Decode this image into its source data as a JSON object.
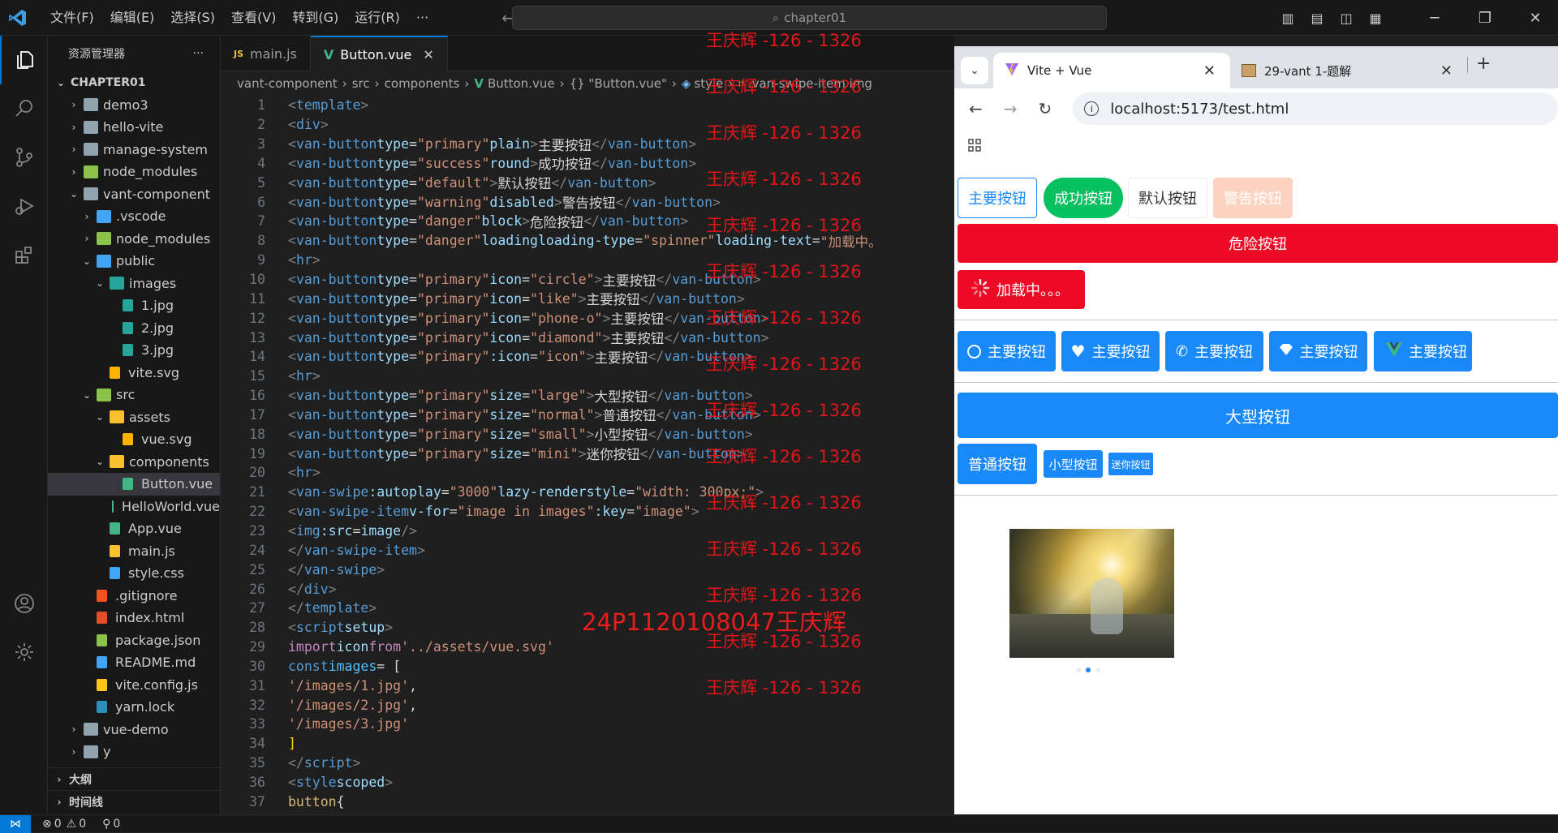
{
  "titlebar": {
    "menu": [
      "文件(F)",
      "编辑(E)",
      "选择(S)",
      "查看(V)",
      "转到(G)",
      "运行(R)",
      "···"
    ],
    "search_text": "chapter01"
  },
  "sidebar": {
    "title": "资源管理器",
    "more": "···",
    "root": "CHAPTER01",
    "items": [
      {
        "label": "demo3",
        "level": 1,
        "kind": "folder",
        "tw": "›"
      },
      {
        "label": "hello-vite",
        "level": 1,
        "kind": "folder",
        "tw": "›"
      },
      {
        "label": "manage-system",
        "level": 1,
        "kind": "folder",
        "tw": "›"
      },
      {
        "label": "node_modules",
        "level": 1,
        "kind": "folder-green",
        "tw": "›"
      },
      {
        "label": "vant-component",
        "level": 1,
        "kind": "folder",
        "tw": "⌄"
      },
      {
        "label": ".vscode",
        "level": 2,
        "kind": "folder-blue",
        "tw": "›"
      },
      {
        "label": "node_modules",
        "level": 2,
        "kind": "folder-green",
        "tw": "›"
      },
      {
        "label": "public",
        "level": 2,
        "kind": "folder-blue",
        "tw": "⌄"
      },
      {
        "label": "images",
        "level": 3,
        "kind": "folder-teal",
        "tw": "⌄"
      },
      {
        "label": "1.jpg",
        "level": 4,
        "kind": "image",
        "tw": ""
      },
      {
        "label": "2.jpg",
        "level": 4,
        "kind": "image",
        "tw": ""
      },
      {
        "label": "3.jpg",
        "level": 4,
        "kind": "image",
        "tw": ""
      },
      {
        "label": "vite.svg",
        "level": 3,
        "kind": "svg",
        "tw": ""
      },
      {
        "label": "src",
        "level": 2,
        "kind": "folder-green",
        "tw": "⌄"
      },
      {
        "label": "assets",
        "level": 3,
        "kind": "folder-yellow",
        "tw": "⌄"
      },
      {
        "label": "vue.svg",
        "level": 4,
        "kind": "svg",
        "tw": ""
      },
      {
        "label": "components",
        "level": 3,
        "kind": "folder-yellow",
        "tw": "⌄"
      },
      {
        "label": "Button.vue",
        "level": 4,
        "kind": "vue",
        "tw": "",
        "selected": true
      },
      {
        "label": "HelloWorld.vue",
        "level": 4,
        "kind": "vue",
        "tw": ""
      },
      {
        "label": "App.vue",
        "level": 3,
        "kind": "vue",
        "tw": ""
      },
      {
        "label": "main.js",
        "level": 3,
        "kind": "js",
        "tw": ""
      },
      {
        "label": "style.css",
        "level": 3,
        "kind": "css",
        "tw": ""
      },
      {
        "label": ".gitignore",
        "level": 2,
        "kind": "git",
        "tw": ""
      },
      {
        "label": "index.html",
        "level": 2,
        "kind": "html",
        "tw": ""
      },
      {
        "label": "package.json",
        "level": 2,
        "kind": "json",
        "tw": ""
      },
      {
        "label": "README.md",
        "level": 2,
        "kind": "info",
        "tw": ""
      },
      {
        "label": "vite.config.js",
        "level": 2,
        "kind": "vite",
        "tw": ""
      },
      {
        "label": "yarn.lock",
        "level": 2,
        "kind": "yarn",
        "tw": ""
      },
      {
        "label": "vue-demo",
        "level": 1,
        "kind": "folder",
        "tw": "›"
      },
      {
        "label": "y",
        "level": 1,
        "kind": "folder",
        "tw": "›"
      }
    ],
    "outline": "大纲",
    "timeline": "时间线"
  },
  "editor": {
    "tabs": [
      {
        "label": "main.js",
        "active": false
      },
      {
        "label": "Button.vue",
        "active": true
      }
    ],
    "breadcrumb": [
      "vant-component",
      "src",
      "components",
      "Button.vue",
      "{} \"Button.vue\"",
      "style",
      ".van-swipe-item img"
    ],
    "line_numbers": [
      "1",
      "2",
      "3",
      "4",
      "5",
      "6",
      "7",
      "8",
      "9",
      "10",
      "11",
      "12",
      "13",
      "14",
      "15",
      "16",
      "17",
      "18",
      "19",
      "20",
      "21",
      "22",
      "23",
      "24",
      "25",
      "26",
      "27",
      "28",
      "29",
      "30",
      "31",
      "32",
      "33",
      "34",
      "35",
      "36",
      "37"
    ],
    "watermark": "王庆辉 -126 - 1326",
    "watermark2": "24P1120108047王庆辉"
  },
  "browser": {
    "tabs": [
      {
        "title": "Vite + Vue",
        "active": true
      },
      {
        "title": "29-vant 1-题解",
        "active": false
      }
    ],
    "url": "localhost:5173/test.html",
    "buttons": {
      "primary": "主要按钮",
      "success": "成功按钮",
      "default": "默认按钮",
      "warning": "警告按钮",
      "danger": "危险按钮",
      "loading": "加载中。。。",
      "large": "大型按钮",
      "small": "小型按钮",
      "mini": "迷你按钮"
    },
    "swipe_indicator": {
      "count": 3,
      "active": 2
    }
  },
  "statusbar": {
    "errors": "0",
    "warnings": "0",
    "ports": "0"
  }
}
